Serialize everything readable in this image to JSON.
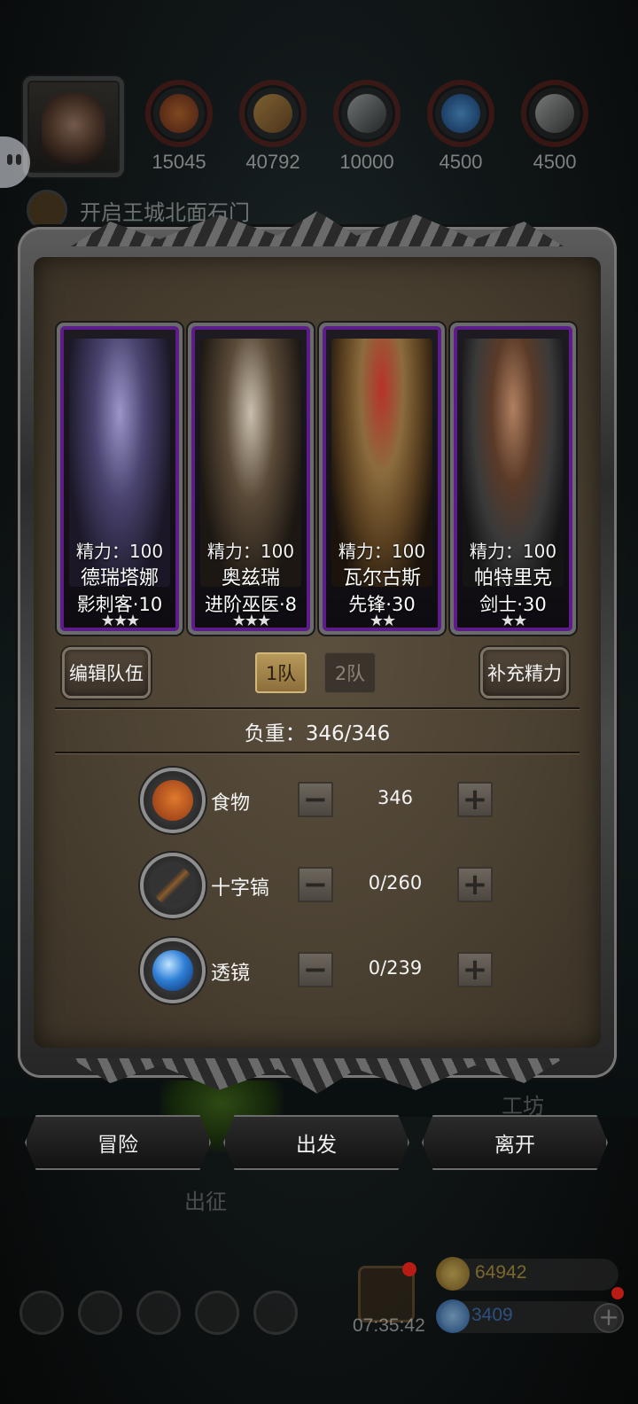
{
  "resources": [
    {
      "icon": "food-icon",
      "value": "15045",
      "color": "#c8581f"
    },
    {
      "icon": "wood-icon",
      "value": "40792",
      "color": "#b47a2e"
    },
    {
      "icon": "iron-icon",
      "value": "10000",
      "color": "#8a8a8a"
    },
    {
      "icon": "crystal-icon",
      "value": "4500",
      "color": "#2f7fd6"
    },
    {
      "icon": "stone-icon",
      "value": "4500",
      "color": "#9a9a9a"
    }
  ],
  "quest": {
    "text": "开启王城北面石门"
  },
  "heroes": [
    {
      "stat": "精力：100",
      "name": "德瑞塔娜",
      "class": "影刺客·10",
      "stars": "★★★"
    },
    {
      "stat": "精力：100",
      "name": "奥兹瑞",
      "class": "进阶巫医·8",
      "stars": "★★★"
    },
    {
      "stat": "精力：100",
      "name": "瓦尔古斯",
      "class": "先锋·30",
      "stars": "★★"
    },
    {
      "stat": "精力：100",
      "name": "帕特里克",
      "class": "剑士·30",
      "stars": "★★"
    }
  ],
  "team": {
    "edit_label": "编辑队伍",
    "tabs": [
      "1队",
      "2队"
    ],
    "active_tab": "1队",
    "refill_label": "补充精力"
  },
  "load": {
    "title": "负重：346/346"
  },
  "supplies": [
    {
      "icon": "food-icon",
      "label": "食物",
      "qty": "346",
      "minus": "−",
      "plus": "+"
    },
    {
      "icon": "pickaxe-icon",
      "label": "十字镐",
      "qty": "0/260",
      "minus": "−",
      "plus": "+"
    },
    {
      "icon": "lens-icon",
      "label": "透镜",
      "qty": "0/239",
      "minus": "−",
      "plus": "+"
    }
  ],
  "actions": {
    "adventure": "冒险",
    "depart": "出发",
    "leave": "离开"
  },
  "background_labels": {
    "expedition": "出征",
    "workshop": "工坊"
  },
  "hud": {
    "timer": "07:35:42",
    "gold": "64942",
    "gems": "3409"
  },
  "colors": {
    "accent_purple": "#5d1c8a",
    "gold_text": "#c9a43c",
    "gem_text": "#3a78d0"
  }
}
